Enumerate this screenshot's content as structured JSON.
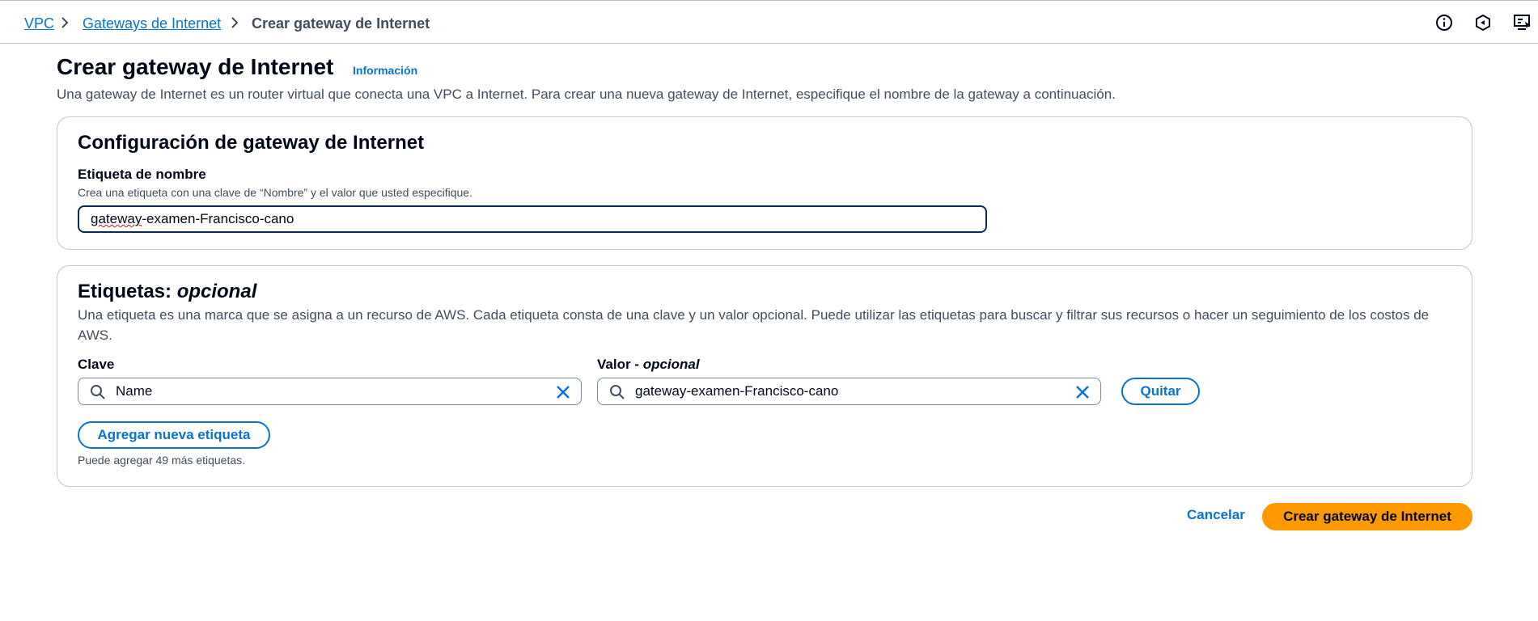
{
  "breadcrumb": {
    "items": [
      "VPC",
      "Gateways de Internet",
      "Crear gateway de Internet"
    ]
  },
  "toolbar": {
    "icons": [
      "info-icon",
      "feedback-icon",
      "screen-icon"
    ]
  },
  "page": {
    "title": "Crear gateway de Internet",
    "info_link": "Información",
    "description": "Una gateway de Internet es un router virtual que conecta una VPC a Internet. Para crear una nueva gateway de Internet, especifique el nombre de la gateway a continuación."
  },
  "config_section": {
    "heading": "Configuración de gateway de Internet",
    "name_label": "Etiqueta de nombre",
    "name_description": "Crea una etiqueta con una clave de “Nombre” y el valor que usted especifique.",
    "name_value_part1": "gateway",
    "name_value_part2": "-examen-Francisco-cano"
  },
  "tags_section": {
    "heading": "Etiquetas:",
    "heading_optional": "opcional",
    "description": "Una etiqueta es una marca que se asigna a un recurso de AWS. Cada etiqueta consta de una clave y un valor opcional. Puede utilizar las etiquetas para buscar y filtrar sus recursos o hacer un seguimiento de los costos de AWS.",
    "key_label": "Clave",
    "value_label": "Valor -",
    "value_optional": "opcional",
    "tag_key": "Name",
    "tag_value": "gateway-examen-Francisco-cano",
    "remove_button": "Quitar",
    "add_button": "Agregar nueva etiqueta",
    "hint": "Puede agregar 49 más etiquetas."
  },
  "actions": {
    "cancel": "Cancelar",
    "create": "Crear gateway de Internet"
  },
  "colors": {
    "link": "#0972d3",
    "primary_button": "#ff9900",
    "text": "#000716",
    "secondary_text": "#414d5c"
  }
}
